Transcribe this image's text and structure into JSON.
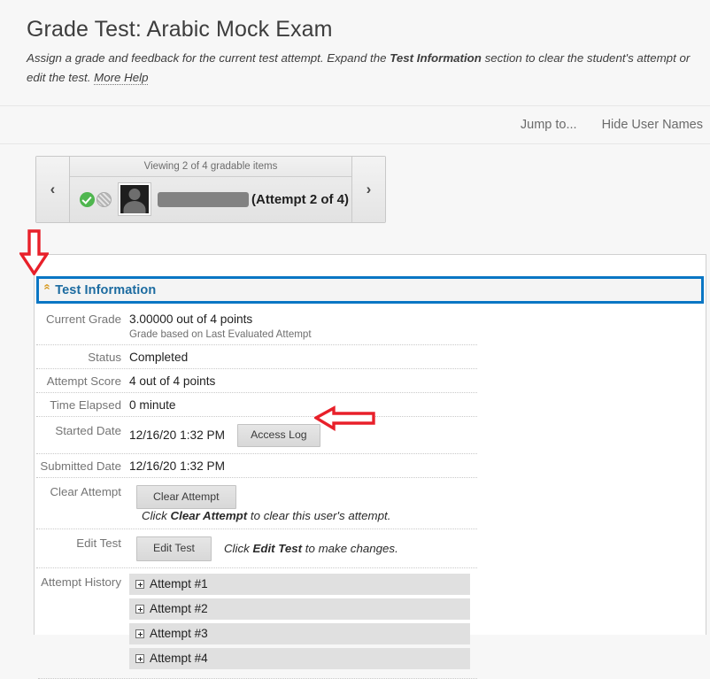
{
  "header": {
    "title": "Grade Test: Arabic Mock Exam",
    "desc_part1": "Assign a grade and feedback for the current test attempt. Expand the ",
    "desc_bold": "Test Information",
    "desc_part2": " section to clear the student's attempt or edit the test. ",
    "more_help": "More Help"
  },
  "action_bar": {
    "jump_to": "Jump to...",
    "hide_user_names": "Hide User Names"
  },
  "student_nav": {
    "prev_icon": "chevron-left-icon",
    "next_icon": "chevron-right-icon",
    "prev_glyph": "‹",
    "next_glyph": "›",
    "viewing_text": "Viewing 2 of 4 gradable items",
    "status_icon": "green-check-icon",
    "needs_grading_icon": "hatched-circle-icon",
    "avatar_icon": "user-avatar-icon",
    "student_name_redacted": "",
    "attempt_label": "(Attempt 2 of 4)"
  },
  "section": {
    "collapse_icon": "double-chevron-up-icon",
    "title": "Test Information"
  },
  "details": [
    {
      "label": "Current Grade",
      "value": "3.00000 out of 4 points",
      "note": "Grade based on Last Evaluated Attempt"
    },
    {
      "label": "Status",
      "value": "Completed",
      "note": ""
    },
    {
      "label": "Attempt Score",
      "value": "4 out of 4 points",
      "note": ""
    },
    {
      "label": "Time Elapsed",
      "value": "0 minute",
      "note": ""
    },
    {
      "label": "Started Date",
      "value": "12/16/20 1:32 PM",
      "note": ""
    },
    {
      "label": "Submitted Date",
      "value": "12/16/20 1:32 PM",
      "note": ""
    }
  ],
  "buttons": {
    "access_log": "Access Log",
    "clear_attempt": "Clear Attempt",
    "edit_test": "Edit Test"
  },
  "action_rows": {
    "clear_attempt_label": "Clear Attempt",
    "clear_help_pre": "Click ",
    "clear_help_bold": "Clear Attempt",
    "clear_help_post": " to clear this user's attempt.",
    "edit_test_label": "Edit Test",
    "edit_help_pre": "Click ",
    "edit_help_bold": "Edit Test",
    "edit_help_post": " to make changes."
  },
  "attempt_history": {
    "label": "Attempt History",
    "items": [
      {
        "label": "Attempt #1"
      },
      {
        "label": "Attempt #2"
      },
      {
        "label": "Attempt #3"
      },
      {
        "label": "Attempt #4"
      }
    ]
  },
  "annotations": {
    "arrow_down": "red-down-arrow-annotation",
    "arrow_left": "red-left-arrow-annotation",
    "color": "#e8202a"
  },
  "colors": {
    "section_border": "#0a76c4",
    "section_title": "#1c6ba0",
    "collapse_icon": "#d79a20",
    "status_green": "#4fb64f",
    "annotation_red": "#e8202a"
  }
}
